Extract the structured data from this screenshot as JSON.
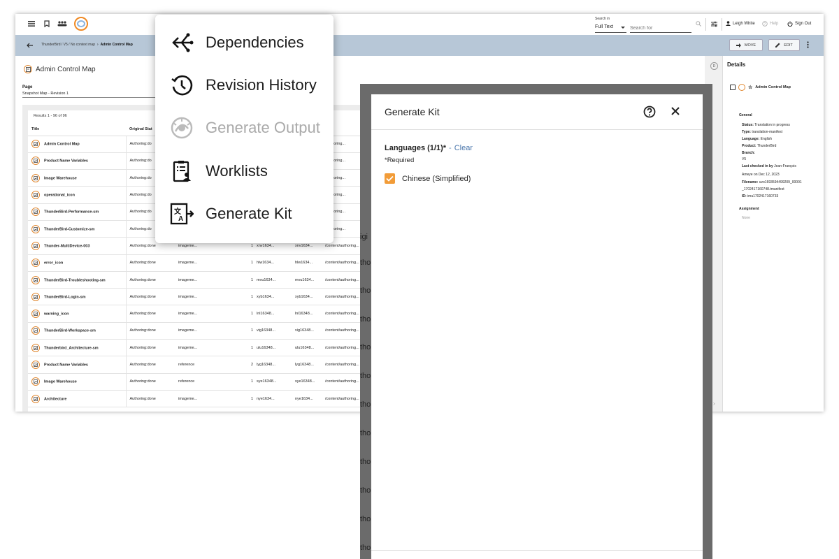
{
  "topbar": {
    "search_in_label": "Search in",
    "search_scope": "Full Text",
    "search_placeholder": "Search for",
    "user_name": "Leigh White",
    "help_label": "Help",
    "signout_label": "Sign Out"
  },
  "breadcrumb": {
    "path": "ThunderBird / V5 / No context map",
    "current": "Admin Control Map"
  },
  "actions": {
    "move_label": "MOVE",
    "edit_label": "EDIT"
  },
  "page": {
    "title": "Admin Control Map",
    "page_label": "Page",
    "page_value": "Snapshot Map - Revision 1"
  },
  "results": {
    "count": "Results 1 - 96 of 96",
    "columns": [
      "Title",
      "Original Stat"
    ],
    "rows": [
      [
        "Admin Control Map",
        "Authoring:do",
        "",
        "",
        "",
        "",
        "/authoring..."
      ],
      [
        "Product Name Variables",
        "Authoring:do",
        "",
        "",
        "",
        "",
        "/authoring..."
      ],
      [
        "Image Warehouse",
        "Authoring:do",
        "",
        "",
        "",
        "",
        "/authoring..."
      ],
      [
        "operational_icon",
        "Authoring:do",
        "",
        "",
        "",
        "",
        "/authoring..."
      ],
      [
        "ThunderBird-Performance-sm",
        "Authoring:do",
        "",
        "",
        "",
        "",
        "/authoring..."
      ],
      [
        "ThunderBird-Customize-sm",
        "Authoring:do",
        "",
        "",
        "",
        "",
        "/authoring..."
      ],
      [
        "Thunder-MultiDevice-003",
        "Authoring:done",
        "imageme...",
        "1",
        "xnv1634...",
        "xnv1634...",
        "/content/authoring..."
      ],
      [
        "error_icon",
        "Authoring:done",
        "imageme...",
        "1",
        "hlw1634...",
        "hlw1634...",
        "/content/authoring..."
      ],
      [
        "ThunderBird-Troubleshooting-sm",
        "Authoring:done",
        "imageme...",
        "1",
        "mvu1634...",
        "mvu1634...",
        "/content/authoring..."
      ],
      [
        "ThunderBird-Login-sm",
        "Authoring:done",
        "imageme...",
        "1",
        "xyb1634...",
        "xyb1634...",
        "/content/authoring..."
      ],
      [
        "warning_icon",
        "Authoring:done",
        "imageme...",
        "1",
        "lnl16348...",
        "lnl16348...",
        "/content/authoring..."
      ],
      [
        "ThunderBird-Workspace-sm",
        "Authoring:done",
        "imageme...",
        "1",
        "vig16348...",
        "vig16348...",
        "/content/authoring..."
      ],
      [
        "Thunderbird_Architecture-sm",
        "Authoring:done",
        "imageme...",
        "1",
        "ulu16348...",
        "ulu16348...",
        "/content/authoring..."
      ],
      [
        "Product Name Variables",
        "Authoring:done",
        "reference",
        "2",
        "lyg16348...",
        "lyg16348...",
        "/content/authoring..."
      ],
      [
        "Image Warehouse",
        "Authoring:done",
        "reference",
        "1",
        "sye16348...",
        "sye16348...",
        "/content/authoring..."
      ],
      [
        "Architecture",
        "Authoring:done",
        "imageme...",
        "1",
        "nye1634...",
        "nye1634...",
        "/content/authoring..."
      ]
    ]
  },
  "details": {
    "rail_letter": "D",
    "title": "Details",
    "item_name": "Admin Control Map",
    "general_label": "General",
    "status_key": "Status:",
    "status_val": "Translation in progress",
    "type_key": "Type:",
    "type_val": "translation-manifest",
    "language_key": "Language:",
    "language_val": "English",
    "product_key": "Product:",
    "product_val": "ThunderBird",
    "branch_key": "Branch:",
    "branch_val": "V5",
    "checked_key": "Last checked in by",
    "checked_val": "Jean-François",
    "checked_val2": "Ameye on Dec 12, 2023",
    "filename_key": "Filename:",
    "filename_val": "uvo1693594499209_00001",
    "filename_val2": "_1702417160748.tmanifest",
    "id_key": "ID:",
    "id_val": "imu1702417160733",
    "assignment_label": "Assignment",
    "assignment_val": "None"
  },
  "menu": {
    "items": [
      {
        "label": "Dependencies",
        "icon": "dependencies-icon",
        "enabled": true
      },
      {
        "label": "Revision History",
        "icon": "history-icon",
        "enabled": true
      },
      {
        "label": "Generate Output",
        "icon": "generate-output-icon",
        "enabled": false
      },
      {
        "label": "Worklists",
        "icon": "worklist-icon",
        "enabled": true
      },
      {
        "label": "Generate Kit",
        "icon": "translate-icon",
        "enabled": true
      }
    ]
  },
  "modal": {
    "title": "Generate Kit",
    "languages_label": "Languages (1/1)*",
    "clear_label": "Clear",
    "required_label": "*Required",
    "language_option": "Chinese (Simplified)"
  },
  "overlay_fragments": [
    "igi",
    "tho",
    "tho",
    "tho",
    "tho",
    "tho",
    "tho",
    "tho",
    "tho",
    "tho",
    "tho",
    "tho"
  ],
  "colors": {
    "accent": "#f29c38",
    "crumb_bar": "#b7c7d7",
    "link": "#4c78ad"
  }
}
